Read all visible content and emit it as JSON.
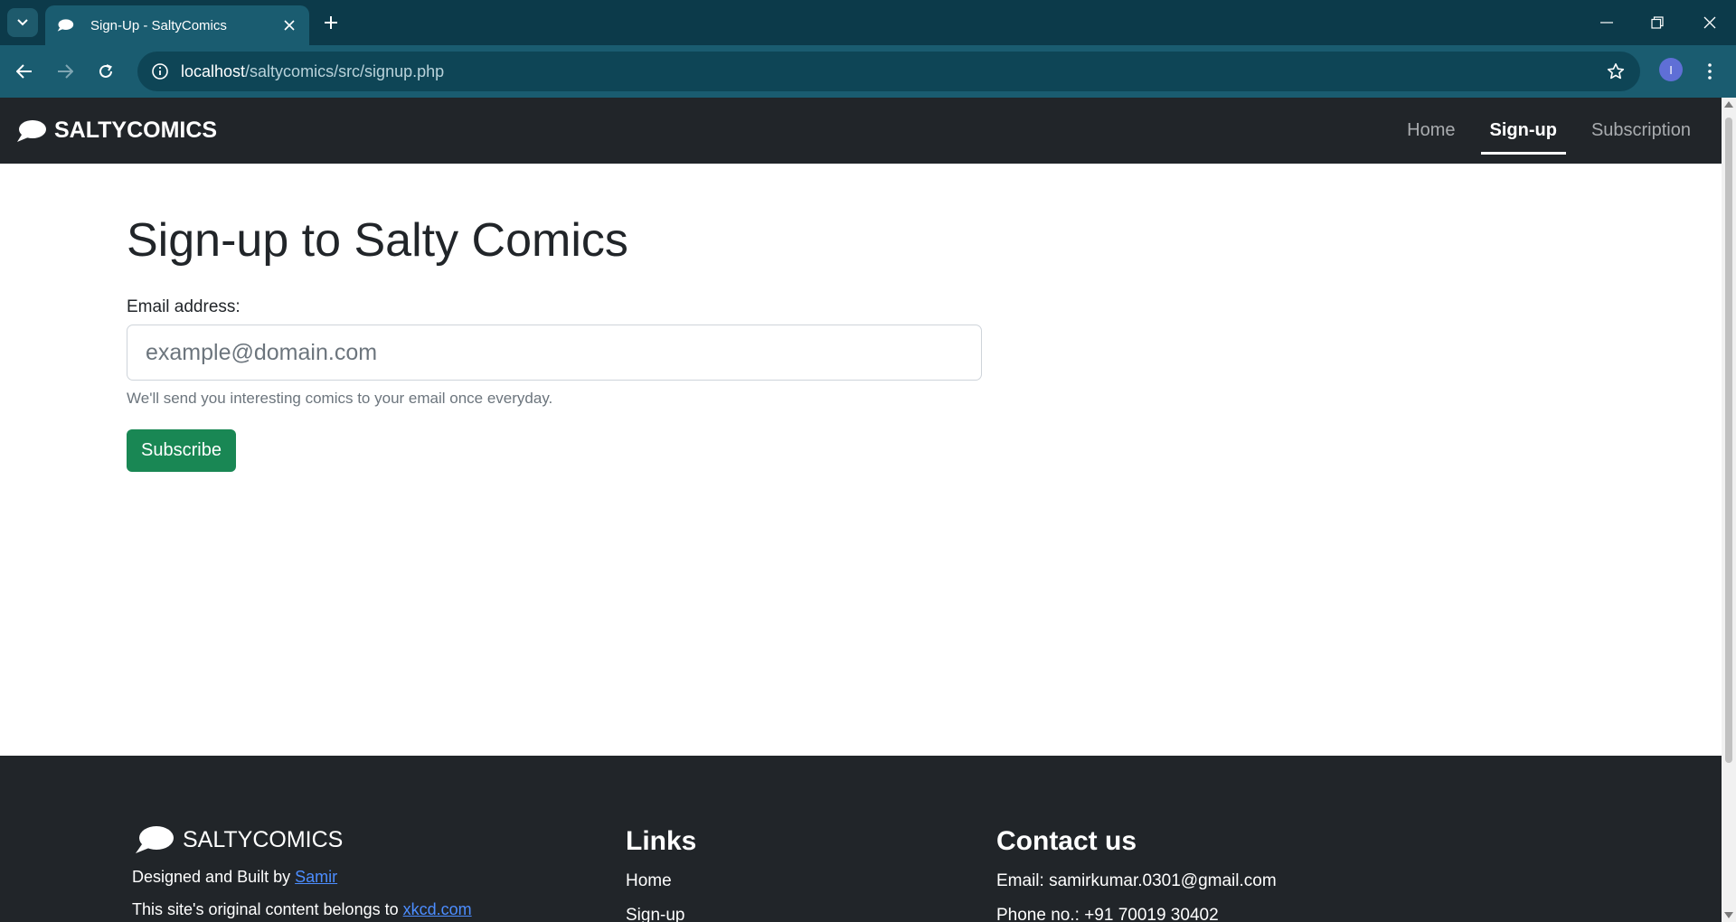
{
  "browser": {
    "tab_title": "Sign-Up - SaltyComics",
    "url_host": "localhost",
    "url_path": "/saltycomics/src/signup.php",
    "profile_initial": "I"
  },
  "site": {
    "brand": "SALTYCOMICS",
    "nav": [
      {
        "label": "Home",
        "active": false
      },
      {
        "label": "Sign-up",
        "active": true
      },
      {
        "label": "Subscription",
        "active": false
      }
    ]
  },
  "form": {
    "heading": "Sign-up to Salty Comics",
    "email_label": "Email address:",
    "email_value": "",
    "email_placeholder": "example@domain.com",
    "help_text": "We'll send you interesting comics to your email once everyday.",
    "submit_label": "Subscribe"
  },
  "footer": {
    "brand": "SALTYCOMICS",
    "designed_prefix": "Designed and Built by ",
    "designer_link": "Samir",
    "content_prefix": "This site's original content belongs to ",
    "content_link": "xkcd.com",
    "links_heading": "Links",
    "links": [
      "Home",
      "Sign-up"
    ],
    "contact_heading": "Contact us",
    "email_line": "Email: samirkumar.0301@gmail.com",
    "phone_line": "Phone no.: +91 70019 30402"
  },
  "colors": {
    "tabstrip": "#0c3a4a",
    "toolbar": "#1a5c70",
    "navbar": "#212529",
    "button": "#198754",
    "link": "#4c8dff"
  }
}
